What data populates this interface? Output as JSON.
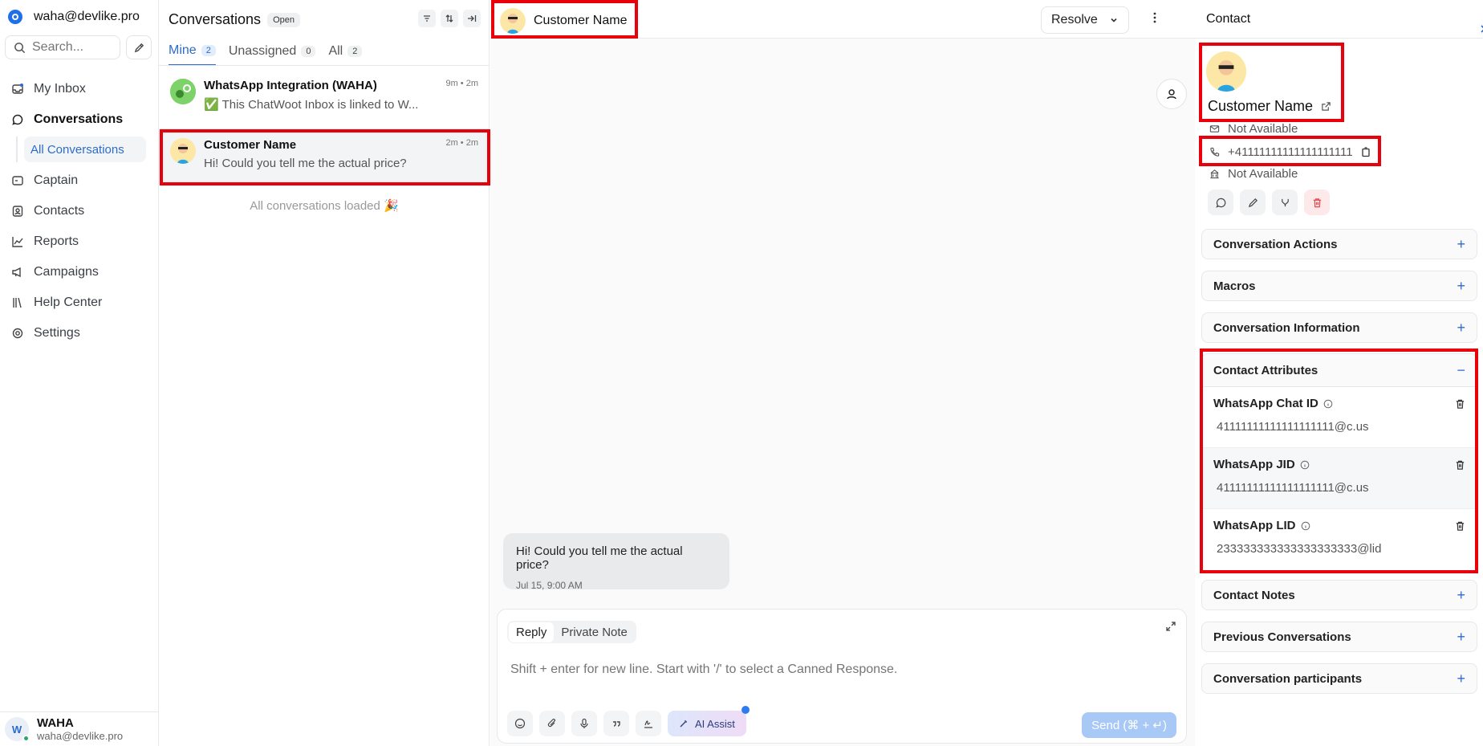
{
  "account": {
    "email": "waha@devlike.pro"
  },
  "sidebar": {
    "search_placeholder": "Search...",
    "items": [
      {
        "label": "My Inbox",
        "icon": "inbox-icon"
      },
      {
        "label": "Conversations",
        "icon": "chat-bubble-icon"
      },
      {
        "label": "All Conversations"
      },
      {
        "label": "Captain",
        "icon": "captain-icon"
      },
      {
        "label": "Contacts",
        "icon": "contacts-icon"
      },
      {
        "label": "Reports",
        "icon": "chart-line-icon"
      },
      {
        "label": "Campaigns",
        "icon": "megaphone-icon"
      },
      {
        "label": "Help Center",
        "icon": "book-icon"
      },
      {
        "label": "Settings",
        "icon": "gear-icon"
      }
    ],
    "user": {
      "initial": "W",
      "name": "WAHA",
      "email": "waha@devlike.pro"
    }
  },
  "list": {
    "title": "Conversations",
    "status": "Open",
    "tabs": [
      {
        "label": "Mine",
        "count": "2"
      },
      {
        "label": "Unassigned",
        "count": "0"
      },
      {
        "label": "All",
        "count": "2"
      }
    ],
    "conversations": [
      {
        "name": "WhatsApp Integration (WAHA)",
        "time": "9m • 2m",
        "message": "✅ This ChatWoot Inbox is linked to W..."
      },
      {
        "name": "Customer Name",
        "time": "2m • 2m",
        "message": "Hi! Could you tell me the actual price?"
      }
    ],
    "footer": "All conversations loaded 🎉"
  },
  "chat": {
    "contact_name": "Customer Name",
    "resolve_label": "Resolve",
    "message": {
      "text": "Hi! Could you tell me the actual price?",
      "date": "Jul 15, 9:00 AM"
    },
    "reply": {
      "tab_reply": "Reply",
      "tab_note": "Private Note",
      "placeholder": "Shift + enter for new line. Start with '/' to select a Canned Response.",
      "ai_label": "AI Assist",
      "send_label": "Send (⌘ + ↵)"
    }
  },
  "contact": {
    "panel_title": "Contact",
    "name": "Customer Name",
    "email": "Not Available",
    "phone": "+41111111111111111111",
    "company": "Not Available",
    "sections": {
      "conversation_actions": "Conversation Actions",
      "macros": "Macros",
      "conversation_information": "Conversation Information",
      "contact_attributes": "Contact Attributes",
      "contact_notes": "Contact Notes",
      "previous_conversations": "Previous Conversations",
      "conversation_participants": "Conversation participants"
    },
    "attributes": [
      {
        "key": "WhatsApp Chat ID",
        "value": "41111111111111111111@c.us"
      },
      {
        "key": "WhatsApp JID",
        "value": "41111111111111111111@c.us"
      },
      {
        "key": "WhatsApp LID",
        "value": "233333333333333333333@lid"
      }
    ]
  },
  "colors": {
    "accent": "#2b6ccc",
    "highlight": "#e8000b",
    "send": "#a8c8f5"
  }
}
